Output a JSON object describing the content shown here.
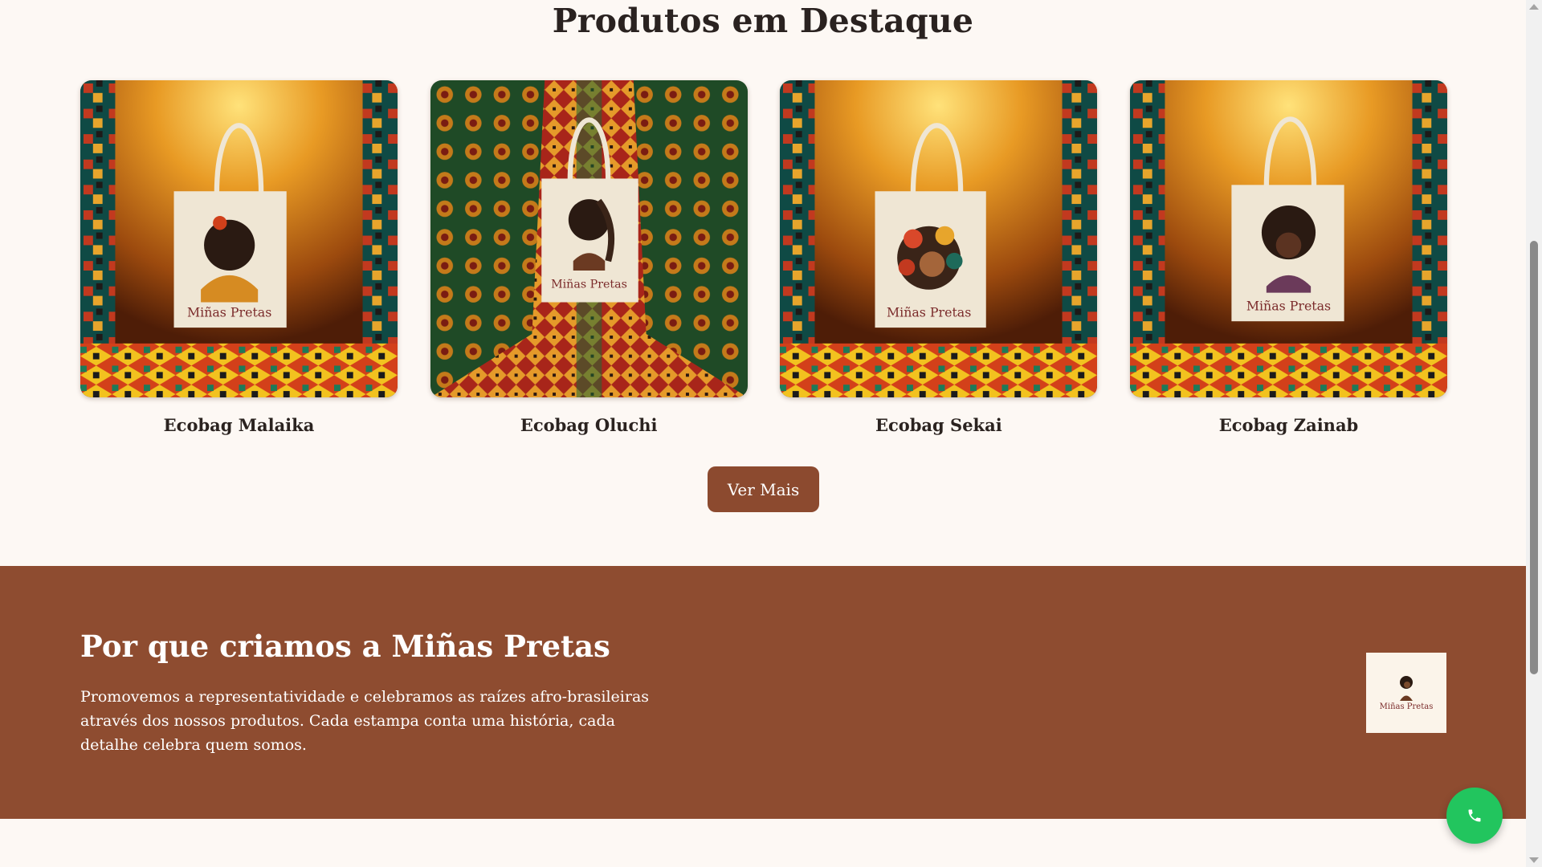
{
  "featured": {
    "title": "Produtos em Destaque",
    "products": [
      {
        "name": "Ecobag Malaika",
        "bag_text": "Miñas Pretas",
        "backdrop": "orange-stage"
      },
      {
        "name": "Ecobag Oluchi",
        "bag_text": "Miñas Pretas",
        "backdrop": "red-green-carpet"
      },
      {
        "name": "Ecobag Sekai",
        "bag_text": "Miñas Pretas",
        "backdrop": "orange-stage"
      },
      {
        "name": "Ecobag Zainab",
        "bag_text": "Miñas Pretas",
        "backdrop": "orange-stage"
      }
    ],
    "see_more_label": "Ver Mais"
  },
  "about": {
    "title": "Por que criamos a Miñas Pretas",
    "text": "Promovemos a representatividade e celebramos as raízes afro-brasileiras através dos nossos produtos. Cada estampa conta uma história, cada detalhe celebra quem somos.",
    "logo_text": "Miñas Pretas"
  },
  "whatsapp": {
    "icon": "phone-icon"
  },
  "colors": {
    "page_background": "#fdf8f4",
    "brand_brown": "#8e4c30",
    "button_brown": "#8c4a2f",
    "whatsapp_green": "#22c55e",
    "bag_text_red": "#7b2b2b"
  }
}
